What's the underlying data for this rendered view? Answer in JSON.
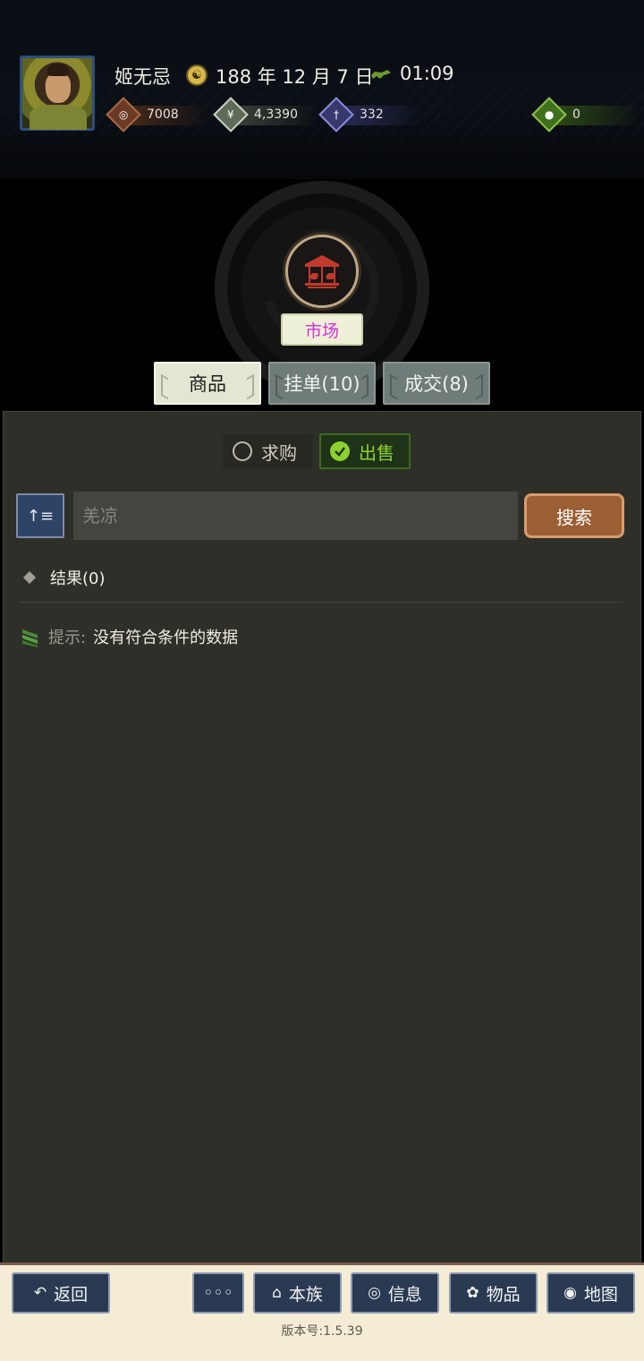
{
  "header": {
    "player_name": "姬无忌",
    "date": "188 年 12 月 7 日",
    "time": "01:09",
    "resources": {
      "coin": "7008",
      "food": "4,3390",
      "power": "332",
      "bag": "0"
    }
  },
  "market": {
    "title": "市场",
    "tabs": {
      "goods": "商品",
      "orders": "挂单(10)",
      "deals": "成交(8)"
    },
    "filters": {
      "buy": "求购",
      "sell": "出售",
      "selected": "sell"
    },
    "search": {
      "sort_icon": "↑≡",
      "placeholder": "羌凉",
      "button": "搜索"
    },
    "results_label": "结果(0)",
    "hint_label": "提示:",
    "hint_text": "没有符合条件的数据"
  },
  "bottom_nav": {
    "back": "返回",
    "more": "◦◦◦",
    "clan": "本族",
    "messages": "信息",
    "items": "物品",
    "map": "地图"
  },
  "version": "版本号:1.5.39",
  "colors": {
    "accent_green": "#8ed12f",
    "market_label": "#d531d8",
    "search_button": "#9c5e33",
    "nav_button": "#2a3a52"
  }
}
